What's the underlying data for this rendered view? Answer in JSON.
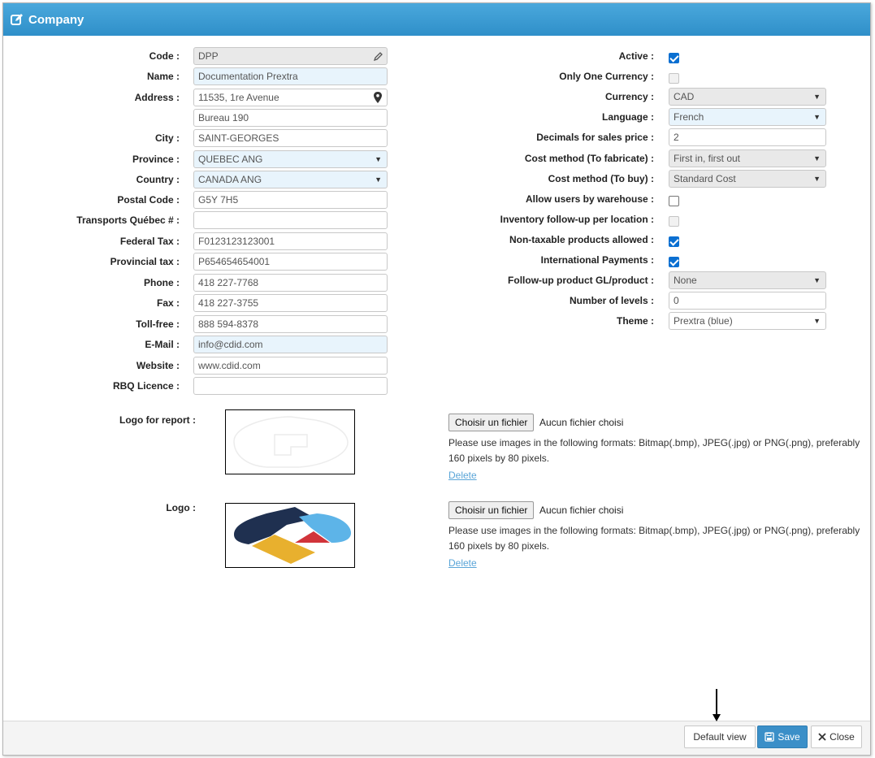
{
  "window": {
    "title": "Company"
  },
  "left_fields": [
    {
      "label": "Code :",
      "value": "DPP"
    },
    {
      "label": "Name :",
      "value": "Documentation Prextra"
    },
    {
      "label": "Address :",
      "value": "11535, 1re Avenue"
    },
    {
      "label": "",
      "value": "Bureau 190"
    },
    {
      "label": "City :",
      "value": "SAINT-GEORGES"
    },
    {
      "label": "Province :",
      "value": "QUEBEC ANG"
    },
    {
      "label": "Country :",
      "value": "CANADA ANG"
    },
    {
      "label": "Postal Code :",
      "value": "G5Y 7H5"
    },
    {
      "label": "Transports Québec # :",
      "value": ""
    },
    {
      "label": "Federal Tax :",
      "value": "F0123123123001"
    },
    {
      "label": "Provincial tax :",
      "value": "P654654654001"
    },
    {
      "label": "Phone :",
      "value": "418 227-7768"
    },
    {
      "label": "Fax :",
      "value": "418 227-3755"
    },
    {
      "label": "Toll-free :",
      "value": "888 594-8378"
    },
    {
      "label": "E-Mail :",
      "value": "info@cdid.com"
    },
    {
      "label": "Website :",
      "value": "www.cdid.com"
    },
    {
      "label": "RBQ Licence :",
      "value": ""
    }
  ],
  "right_fields": [
    {
      "label": "Active :",
      "type": "checkbox",
      "checked": true
    },
    {
      "label": "Only One Currency :",
      "type": "checkbox",
      "checked": false,
      "disabled": true
    },
    {
      "label": "Currency :",
      "type": "select",
      "value": "CAD"
    },
    {
      "label": "Language :",
      "type": "select",
      "value": "French"
    },
    {
      "label": "Decimals for sales price :",
      "type": "input",
      "value": "2"
    },
    {
      "label": "Cost method (To fabricate) :",
      "type": "select",
      "value": "First in, first out"
    },
    {
      "label": "Cost method (To buy) :",
      "type": "select",
      "value": "Standard Cost"
    },
    {
      "label": "Allow users by warehouse :",
      "type": "checkbox",
      "checked": false
    },
    {
      "label": "Inventory follow-up per location :",
      "type": "checkbox",
      "checked": false,
      "disabled": true
    },
    {
      "label": "Non-taxable products allowed :",
      "type": "checkbox",
      "checked": true
    },
    {
      "label": "International Payments :",
      "type": "checkbox",
      "checked": true
    },
    {
      "label": "Follow-up product GL/product :",
      "type": "select",
      "value": "None"
    },
    {
      "label": "Number of levels :",
      "type": "input",
      "value": "0"
    },
    {
      "label": "Theme :",
      "type": "select",
      "value": "Prextra (blue)"
    }
  ],
  "logos": [
    {
      "label": "Logo for report :",
      "file_button": "Choisir un fichier",
      "file_status": "Aucun fichier choisi",
      "help": "Please use images in the following formats: Bitmap(.bmp), JPEG(.jpg) or PNG(.png), preferably 160 pixels by 80 pixels.",
      "delete": "Delete"
    },
    {
      "label": "Logo :",
      "file_button": "Choisir un fichier",
      "file_status": "Aucun fichier choisi",
      "help": "Please use images in the following formats: Bitmap(.bmp), JPEG(.jpg) or PNG(.png), preferably 160 pixels by 80 pixels.",
      "delete": "Delete"
    }
  ],
  "footer": {
    "default_view": "Default view",
    "save": "Save",
    "close": "Close"
  },
  "colors": {
    "title_bar": "#2f8fc9",
    "save_button": "#3b8fc8",
    "checkbox_checked": "#0a6fd1",
    "logo_navy": "#1f3050",
    "logo_blue": "#5db4e8",
    "logo_red": "#d1343a",
    "logo_yellow": "#e8b02e"
  }
}
